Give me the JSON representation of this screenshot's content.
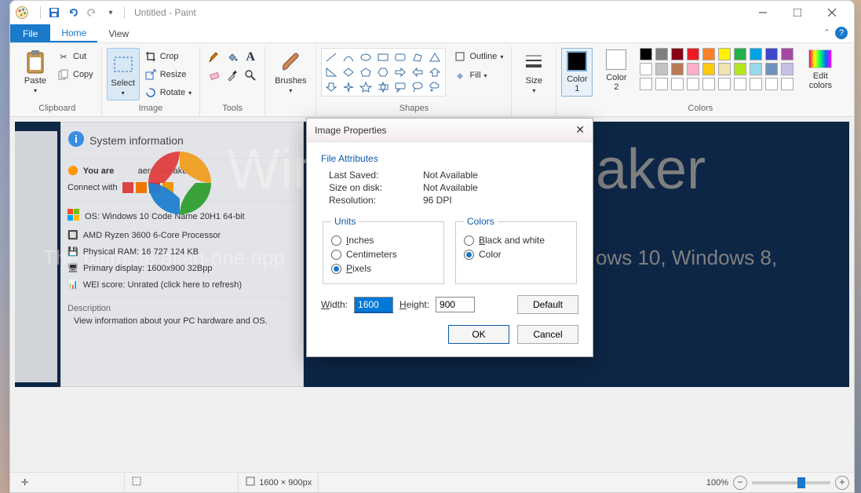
{
  "title": {
    "document": "Untitled",
    "app": "Paint"
  },
  "tabs": {
    "file": "File",
    "home": "Home",
    "view": "View"
  },
  "ribbon": {
    "clipboard": {
      "label": "Clipboard",
      "paste": "Paste",
      "cut": "Cut",
      "copy": "Copy"
    },
    "image": {
      "label": "Image",
      "select": "Select",
      "crop": "Crop",
      "resize": "Resize",
      "rotate": "Rotate"
    },
    "tools": {
      "label": "Tools"
    },
    "brushes": {
      "label": "Brushes"
    },
    "shapes": {
      "label": "Shapes",
      "outline": "Outline",
      "fill": "Fill"
    },
    "size": {
      "label": "Size"
    },
    "colors": {
      "label": "Colors",
      "c1": "Color 1",
      "c2": "Color 2",
      "edit": "Edit colors"
    }
  },
  "palette_row1": [
    "#000000",
    "#7f7f7f",
    "#880015",
    "#ed1c24",
    "#ff7f27",
    "#fff200",
    "#22b14c",
    "#00a2e8",
    "#3f48cc",
    "#a349a4"
  ],
  "palette_row2": [
    "#ffffff",
    "#c3c3c3",
    "#b97a57",
    "#ffaec9",
    "#ffc90e",
    "#efe4b0",
    "#b5e61d",
    "#99d9ea",
    "#7092be",
    "#c8bfe7"
  ],
  "dialog": {
    "title": "Image Properties",
    "file_attrs": {
      "hdr": "File Attributes",
      "last_saved_l": "Last Saved:",
      "last_saved_v": "Not Available",
      "size_l": "Size on disk:",
      "size_v": "Not Available",
      "res_l": "Resolution:",
      "res_v": "96 DPI"
    },
    "units": {
      "legend": "Units",
      "inches": "Inches",
      "cm": "Centimeters",
      "px": "Pixels"
    },
    "colors_fs": {
      "legend": "Colors",
      "bw": "Black and white",
      "color": "Color"
    },
    "width_l": "Width:",
    "width_v": "1600",
    "height_l": "Height:",
    "height_v": "900",
    "default": "Default",
    "ok": "OK",
    "cancel": "Cancel"
  },
  "canvas_bg": {
    "sysinfo_title": "System information",
    "line1": "You are",
    "line1b": "aero Tweaker",
    "connect": "Connect with",
    "os": "OS: Windows 10 Code Name 20H1 64-bit",
    "cpu": "AMD Ryzen 3600 6-Core Processor",
    "ram": "Physical RAM: 16 727 124 KB",
    "disp": "Primary display: 1600x900 32Bpp",
    "wei": "WEI score: Unrated (click here to refresh)",
    "desc_h": "Description",
    "desc": "View information about your PC hardware and OS.",
    "brand1": "Win",
    "brand2": "aker",
    "tagline_a": "The ultimate all-in-one app",
    "tagline_b": "ows 10, Windows 8,"
  },
  "status": {
    "dims": "1600 × 900px",
    "zoom": "100%"
  }
}
